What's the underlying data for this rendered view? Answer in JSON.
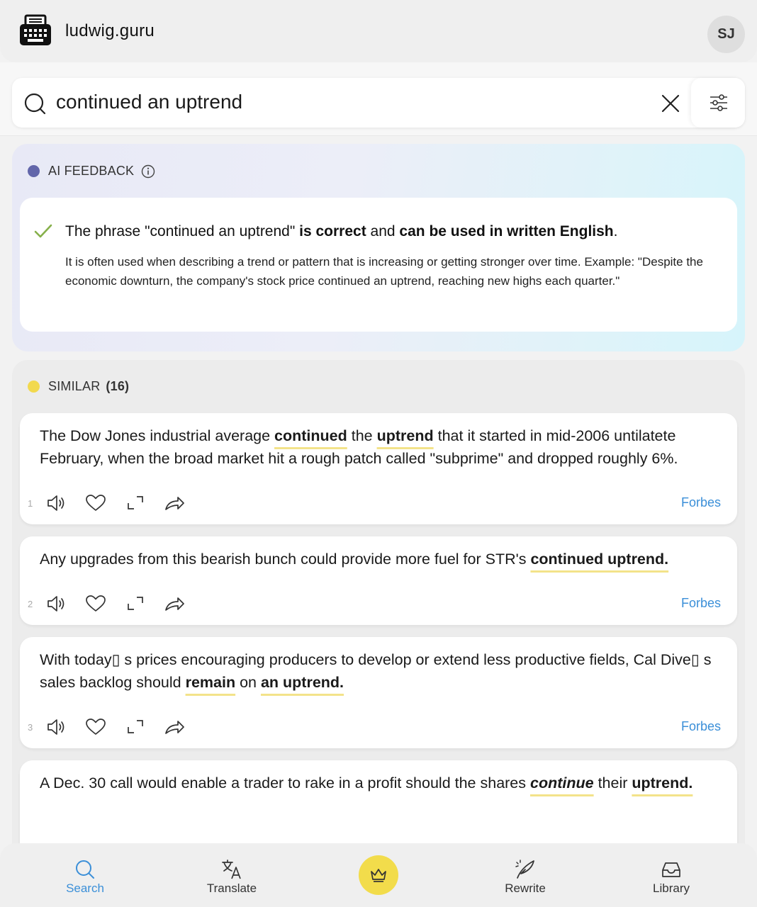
{
  "header": {
    "brand": "ludwig.guru",
    "avatar_initials": "SJ"
  },
  "search": {
    "query": "continued an uptrend"
  },
  "ai_feedback": {
    "label": "AI FEEDBACK",
    "dot_color": "#6266aa",
    "verdict_prefix": "The phrase \"continued an uptrend\" ",
    "verdict_bold1": "is correct",
    "verdict_mid": " and ",
    "verdict_bold2": "can be used in written English",
    "verdict_suffix": ".",
    "description": "It is often used when describing a trend or pattern that is increasing or getting stronger over time. Example: \"Despite the economic downturn, the company's stock price continued an uptrend, reaching new highs each quarter.\""
  },
  "similar": {
    "label": "SIMILAR",
    "count": "(16)",
    "dot_color": "#f2d94e",
    "examples": [
      {
        "number": "1",
        "source": "Forbes",
        "t0": "The Dow Jones industrial average ",
        "h0": "continued",
        "t1": " the ",
        "h1": "uptrend",
        "t2": " that it started in mid-2006 untilatete February, when the broad market hit a rough patch called \"subprime\" and dropped roughly 6%."
      },
      {
        "number": "2",
        "source": "Forbes",
        "t0": "Any upgrades from this bearish bunch could provide more fuel for STR's ",
        "h0": "continued uptrend."
      },
      {
        "number": "3",
        "source": "Forbes",
        "t0": "With today▯ s prices encouraging producers to develop or extend less productive fields, Cal Dive▯ s sales backlog should ",
        "h0": "remain",
        "t1": " on ",
        "h1": "an uptrend."
      },
      {
        "t0": "A Dec. 30 call would enable a trader to rake in a profit should the shares ",
        "h0": "continue",
        "t1": " their ",
        "h1": "uptrend."
      }
    ]
  },
  "nav": {
    "search": "Search",
    "translate": "Translate",
    "rewrite": "Rewrite",
    "library": "Library",
    "active_color": "#3b8fd8",
    "premium_color": "#f2dc4b"
  }
}
